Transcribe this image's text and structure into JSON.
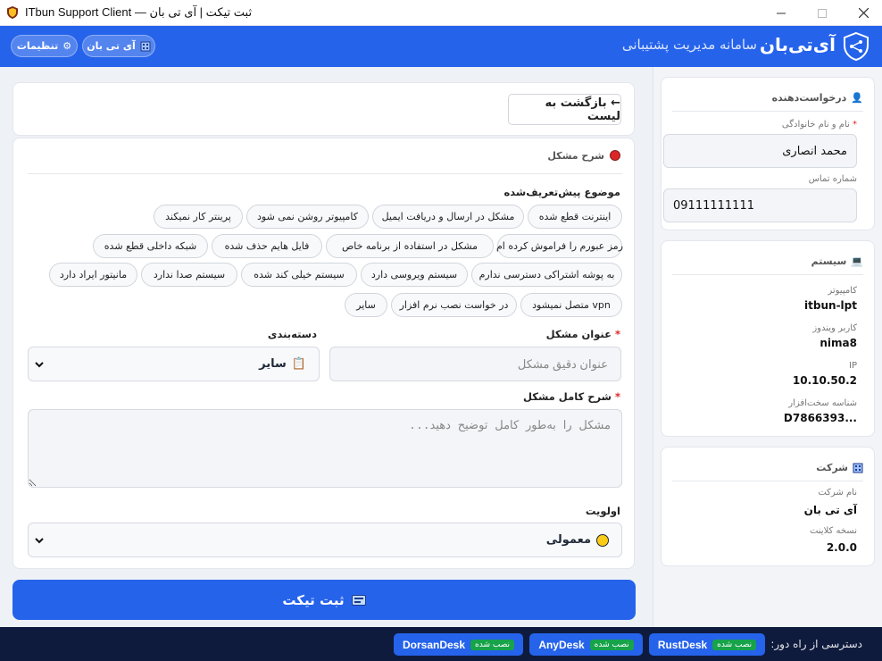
{
  "window": {
    "title": "ITbun Support Client — ثبت تیکت | آی تی بان"
  },
  "header": {
    "brand_name": "آی‌تی‌بان",
    "brand_subtitle": "سامانه مدیریت پشتیبانی",
    "settings_label": "تنظیمات",
    "company_label": "آی تی بان",
    "settings_icon": "gear-icon",
    "company_icon": "building-icon"
  },
  "form": {
    "back_label": "← بازگشت به لیست",
    "section_title": "شرح مشکل",
    "presets_label": "موضوع پیش‌تعریف‌شده",
    "presets": [
      "اینترنت قطع شده",
      "مشکل در ارسال و دریافت ایمیل",
      "کامپیوتر روشن نمی شود",
      "پرینتر کار نمیکند",
      "رمز عبورم را فراموش کرده ام",
      "مشکل در استفاده از برنامه خاص",
      "فایل هایم حذف شده",
      "شبکه داخلی قطع شده",
      "به پوشه اشتراکی دسترسی ندارم",
      "سیستم ویروسی دارد",
      "سیستم خیلی کند شده",
      "سیستم صدا ندارد",
      "مانیتور ایراد دارد",
      "vpn متصل نمیشود",
      "در خواست نصب نرم افزار",
      "سایر"
    ],
    "title_label": "عنوان مشکل",
    "title_placeholder": "عنوان دقیق مشکل",
    "category_label": "دسته‌بندی",
    "category_value": "سایر",
    "description_label": "شرح کامل مشکل",
    "description_placeholder": "مشکل را به‌طور کامل توضیح دهید...",
    "priority_label": "اولویت",
    "priority_value": "معمولی",
    "required_mark": "*",
    "submit_label": "ثبت تیکت"
  },
  "sidebar": {
    "requester": {
      "title": "درخواست‌دهنده",
      "name_label": "نام و نام خانوادگی",
      "name_value": "محمد انصاری",
      "phone_label": "شماره تماس",
      "phone_value": "09111111111"
    },
    "system": {
      "title": "سیستم",
      "computer_label": "کامپیوتر",
      "computer_value": "itbun-lpt",
      "user_label": "کاربر ویندوز",
      "user_value": "nima8",
      "ip_label": "IP",
      "ip_value": "10.10.50.2",
      "hwid_label": "شناسه سخت‌افزار",
      "hwid_value": "D7866393..."
    },
    "company": {
      "title": "شرکت",
      "name_label": "نام شرکت",
      "name_value": "آی تی بان",
      "version_label": "نسخه کلاینت",
      "version_value": "2.0.0"
    }
  },
  "footer": {
    "remote_label": "دسترسی از راه دور:",
    "tools": [
      {
        "name": "RustDesk",
        "status": "نصب شده"
      },
      {
        "name": "AnyDesk",
        "status": "نصب شده"
      },
      {
        "name": "DorsanDesk",
        "status": "نصب شده"
      }
    ]
  },
  "colors": {
    "primary": "#2563eb",
    "footer": "#0f1b3d",
    "installed": "#16a34a",
    "required": "#dc2626",
    "priority_normal": "#facc15"
  }
}
